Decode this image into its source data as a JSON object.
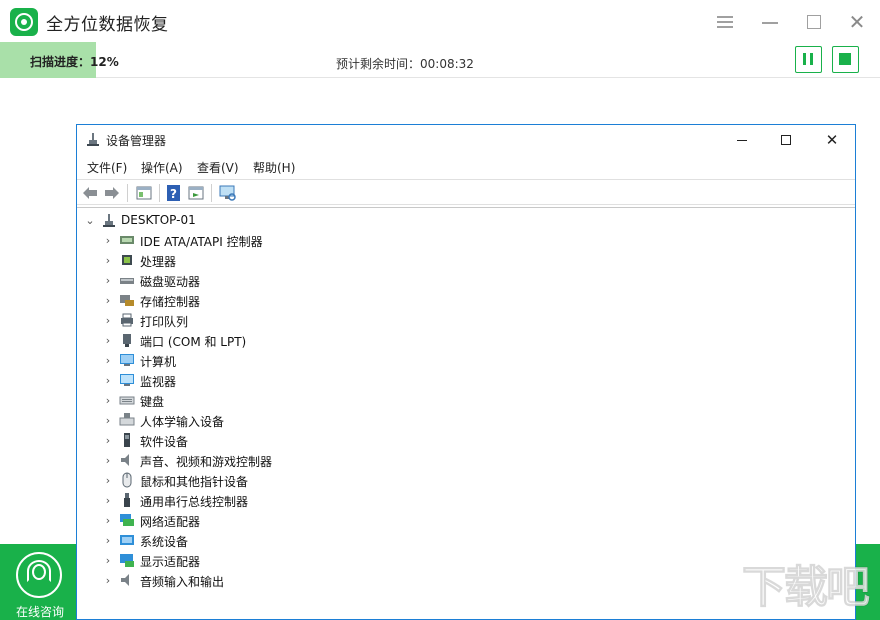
{
  "app": {
    "title": "全方位数据恢复",
    "brand_color": "#19b14a",
    "icons": {
      "logo": "recovery-logo-icon",
      "menu": "hamburger-icon",
      "minimize": "minimize-icon",
      "maximize": "maximize-icon",
      "close": "close-icon"
    }
  },
  "progress": {
    "label": "扫描进度：12%",
    "percent": 12,
    "remaining": "预计剩余时间：00:08:32",
    "fill_color": "#a9e0a9"
  },
  "controls": {
    "pause_icon": "pause-icon",
    "stop_icon": "stop-icon"
  },
  "consult": {
    "label": "在线咨询",
    "icon": "headset-icon"
  },
  "device_manager": {
    "title": "设备管理器",
    "menu": [
      "文件(F)",
      "操作(A)",
      "查看(V)",
      "帮助(H)"
    ],
    "toolbar": [
      "back-icon",
      "forward-icon",
      "properties-icon",
      "help-icon",
      "update-driver-icon",
      "scan-hardware-icon"
    ],
    "root": "DESKTOP-01",
    "items": [
      {
        "label": "IDE ATA/ATAPI 控制器",
        "icon": "ide-controller-icon"
      },
      {
        "label": "处理器",
        "icon": "processor-icon"
      },
      {
        "label": "磁盘驱动器",
        "icon": "disk-drive-icon"
      },
      {
        "label": "存储控制器",
        "icon": "storage-controller-icon"
      },
      {
        "label": "打印队列",
        "icon": "printer-icon"
      },
      {
        "label": "端口 (COM 和 LPT)",
        "icon": "port-icon"
      },
      {
        "label": "计算机",
        "icon": "computer-icon"
      },
      {
        "label": "监视器",
        "icon": "monitor-icon"
      },
      {
        "label": "键盘",
        "icon": "keyboard-icon"
      },
      {
        "label": "人体学输入设备",
        "icon": "hid-icon"
      },
      {
        "label": "软件设备",
        "icon": "software-device-icon"
      },
      {
        "label": "声音、视频和游戏控制器",
        "icon": "sound-icon"
      },
      {
        "label": "鼠标和其他指针设备",
        "icon": "mouse-icon"
      },
      {
        "label": "通用串行总线控制器",
        "icon": "usb-icon"
      },
      {
        "label": "网络适配器",
        "icon": "network-adapter-icon"
      },
      {
        "label": "系统设备",
        "icon": "system-device-icon"
      },
      {
        "label": "显示适配器",
        "icon": "display-adapter-icon"
      },
      {
        "label": "音频输入和输出",
        "icon": "audio-io-icon"
      }
    ]
  },
  "watermark": "下载吧"
}
